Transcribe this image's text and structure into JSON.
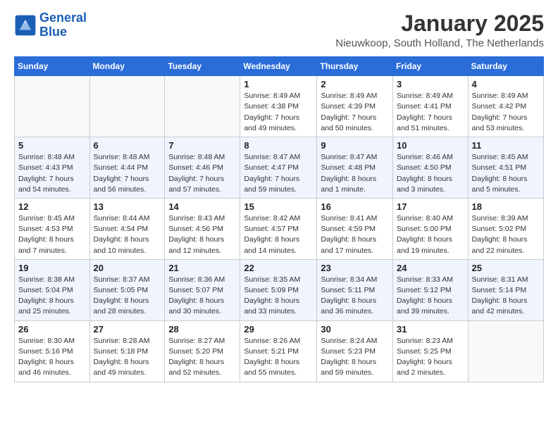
{
  "header": {
    "logo_general": "General",
    "logo_blue": "Blue",
    "month": "January 2025",
    "location": "Nieuwkoop, South Holland, The Netherlands"
  },
  "weekdays": [
    "Sunday",
    "Monday",
    "Tuesday",
    "Wednesday",
    "Thursday",
    "Friday",
    "Saturday"
  ],
  "weeks": [
    [
      {
        "day": "",
        "empty": true
      },
      {
        "day": "",
        "empty": true
      },
      {
        "day": "",
        "empty": true
      },
      {
        "day": "1",
        "sunrise": "Sunrise: 8:49 AM",
        "sunset": "Sunset: 4:38 PM",
        "daylight": "Daylight: 7 hours and 49 minutes."
      },
      {
        "day": "2",
        "sunrise": "Sunrise: 8:49 AM",
        "sunset": "Sunset: 4:39 PM",
        "daylight": "Daylight: 7 hours and 50 minutes."
      },
      {
        "day": "3",
        "sunrise": "Sunrise: 8:49 AM",
        "sunset": "Sunset: 4:41 PM",
        "daylight": "Daylight: 7 hours and 51 minutes."
      },
      {
        "day": "4",
        "sunrise": "Sunrise: 8:49 AM",
        "sunset": "Sunset: 4:42 PM",
        "daylight": "Daylight: 7 hours and 53 minutes."
      }
    ],
    [
      {
        "day": "5",
        "sunrise": "Sunrise: 8:48 AM",
        "sunset": "Sunset: 4:43 PM",
        "daylight": "Daylight: 7 hours and 54 minutes."
      },
      {
        "day": "6",
        "sunrise": "Sunrise: 8:48 AM",
        "sunset": "Sunset: 4:44 PM",
        "daylight": "Daylight: 7 hours and 56 minutes."
      },
      {
        "day": "7",
        "sunrise": "Sunrise: 8:48 AM",
        "sunset": "Sunset: 4:46 PM",
        "daylight": "Daylight: 7 hours and 57 minutes."
      },
      {
        "day": "8",
        "sunrise": "Sunrise: 8:47 AM",
        "sunset": "Sunset: 4:47 PM",
        "daylight": "Daylight: 7 hours and 59 minutes."
      },
      {
        "day": "9",
        "sunrise": "Sunrise: 8:47 AM",
        "sunset": "Sunset: 4:48 PM",
        "daylight": "Daylight: 8 hours and 1 minute."
      },
      {
        "day": "10",
        "sunrise": "Sunrise: 8:46 AM",
        "sunset": "Sunset: 4:50 PM",
        "daylight": "Daylight: 8 hours and 3 minutes."
      },
      {
        "day": "11",
        "sunrise": "Sunrise: 8:45 AM",
        "sunset": "Sunset: 4:51 PM",
        "daylight": "Daylight: 8 hours and 5 minutes."
      }
    ],
    [
      {
        "day": "12",
        "sunrise": "Sunrise: 8:45 AM",
        "sunset": "Sunset: 4:53 PM",
        "daylight": "Daylight: 8 hours and 7 minutes."
      },
      {
        "day": "13",
        "sunrise": "Sunrise: 8:44 AM",
        "sunset": "Sunset: 4:54 PM",
        "daylight": "Daylight: 8 hours and 10 minutes."
      },
      {
        "day": "14",
        "sunrise": "Sunrise: 8:43 AM",
        "sunset": "Sunset: 4:56 PM",
        "daylight": "Daylight: 8 hours and 12 minutes."
      },
      {
        "day": "15",
        "sunrise": "Sunrise: 8:42 AM",
        "sunset": "Sunset: 4:57 PM",
        "daylight": "Daylight: 8 hours and 14 minutes."
      },
      {
        "day": "16",
        "sunrise": "Sunrise: 8:41 AM",
        "sunset": "Sunset: 4:59 PM",
        "daylight": "Daylight: 8 hours and 17 minutes."
      },
      {
        "day": "17",
        "sunrise": "Sunrise: 8:40 AM",
        "sunset": "Sunset: 5:00 PM",
        "daylight": "Daylight: 8 hours and 19 minutes."
      },
      {
        "day": "18",
        "sunrise": "Sunrise: 8:39 AM",
        "sunset": "Sunset: 5:02 PM",
        "daylight": "Daylight: 8 hours and 22 minutes."
      }
    ],
    [
      {
        "day": "19",
        "sunrise": "Sunrise: 8:38 AM",
        "sunset": "Sunset: 5:04 PM",
        "daylight": "Daylight: 8 hours and 25 minutes."
      },
      {
        "day": "20",
        "sunrise": "Sunrise: 8:37 AM",
        "sunset": "Sunset: 5:05 PM",
        "daylight": "Daylight: 8 hours and 28 minutes."
      },
      {
        "day": "21",
        "sunrise": "Sunrise: 8:36 AM",
        "sunset": "Sunset: 5:07 PM",
        "daylight": "Daylight: 8 hours and 30 minutes."
      },
      {
        "day": "22",
        "sunrise": "Sunrise: 8:35 AM",
        "sunset": "Sunset: 5:09 PM",
        "daylight": "Daylight: 8 hours and 33 minutes."
      },
      {
        "day": "23",
        "sunrise": "Sunrise: 8:34 AM",
        "sunset": "Sunset: 5:11 PM",
        "daylight": "Daylight: 8 hours and 36 minutes."
      },
      {
        "day": "24",
        "sunrise": "Sunrise: 8:33 AM",
        "sunset": "Sunset: 5:12 PM",
        "daylight": "Daylight: 8 hours and 39 minutes."
      },
      {
        "day": "25",
        "sunrise": "Sunrise: 8:31 AM",
        "sunset": "Sunset: 5:14 PM",
        "daylight": "Daylight: 8 hours and 42 minutes."
      }
    ],
    [
      {
        "day": "26",
        "sunrise": "Sunrise: 8:30 AM",
        "sunset": "Sunset: 5:16 PM",
        "daylight": "Daylight: 8 hours and 46 minutes."
      },
      {
        "day": "27",
        "sunrise": "Sunrise: 8:28 AM",
        "sunset": "Sunset: 5:18 PM",
        "daylight": "Daylight: 8 hours and 49 minutes."
      },
      {
        "day": "28",
        "sunrise": "Sunrise: 8:27 AM",
        "sunset": "Sunset: 5:20 PM",
        "daylight": "Daylight: 8 hours and 52 minutes."
      },
      {
        "day": "29",
        "sunrise": "Sunrise: 8:26 AM",
        "sunset": "Sunset: 5:21 PM",
        "daylight": "Daylight: 8 hours and 55 minutes."
      },
      {
        "day": "30",
        "sunrise": "Sunrise: 8:24 AM",
        "sunset": "Sunset: 5:23 PM",
        "daylight": "Daylight: 8 hours and 59 minutes."
      },
      {
        "day": "31",
        "sunrise": "Sunrise: 8:23 AM",
        "sunset": "Sunset: 5:25 PM",
        "daylight": "Daylight: 9 hours and 2 minutes."
      },
      {
        "day": "",
        "empty": true
      }
    ]
  ]
}
